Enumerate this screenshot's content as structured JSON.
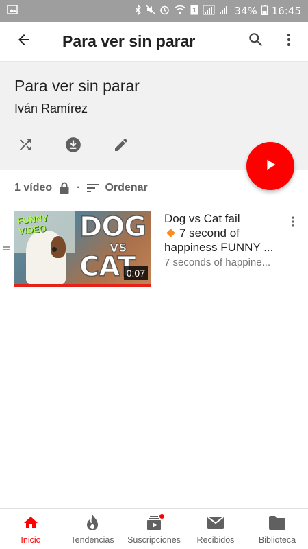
{
  "status_bar": {
    "battery": "34%",
    "time": "16:45",
    "icons": [
      "image-icon",
      "bluetooth-icon",
      "mute-icon",
      "alarm-icon",
      "wifi-icon",
      "sim-icon",
      "signal-icon",
      "signal-icon-2",
      "battery-icon"
    ]
  },
  "app_bar": {
    "title": "Para ver sin parar",
    "back_icon": "arrow-back-icon",
    "search_icon": "search-icon",
    "more_icon": "more-vert-icon"
  },
  "playlist": {
    "title": "Para ver sin parar",
    "owner": "Iván Ramírez",
    "actions": [
      "shuffle-icon",
      "download-icon",
      "edit-icon"
    ],
    "play_all_icon": "play-icon"
  },
  "meta": {
    "count": "1 vídeo",
    "privacy_icon": "lock-icon",
    "separator": "·",
    "sort_label": "Ordenar"
  },
  "videos": [
    {
      "title_line1": "Dog vs Cat fail",
      "title_line2": "7 second of",
      "title_line3": "happiness FUNNY ...",
      "subtitle": "7 seconds of happine...",
      "duration": "0:07",
      "thumb_text_funny_1": "FUNNY",
      "thumb_text_funny_2": "VIDEO",
      "thumb_text_dog": "DOG",
      "thumb_text_vs": "VS",
      "thumb_text_cat": "CAT"
    }
  ],
  "bottom_nav": {
    "items": [
      {
        "label": "Inicio",
        "icon": "home-icon",
        "active": true
      },
      {
        "label": "Tendencias",
        "icon": "trending-icon",
        "active": false
      },
      {
        "label": "Suscripciones",
        "icon": "subscriptions-icon",
        "active": false,
        "badge": true
      },
      {
        "label": "Recibidos",
        "icon": "inbox-icon",
        "active": false
      },
      {
        "label": "Biblioteca",
        "icon": "library-icon",
        "active": false
      }
    ]
  },
  "colors": {
    "accent": "#ff0000",
    "header_bg": "#f1f1f1",
    "status_bar_bg": "#9e9e9e",
    "icon_gray": "#606060"
  }
}
